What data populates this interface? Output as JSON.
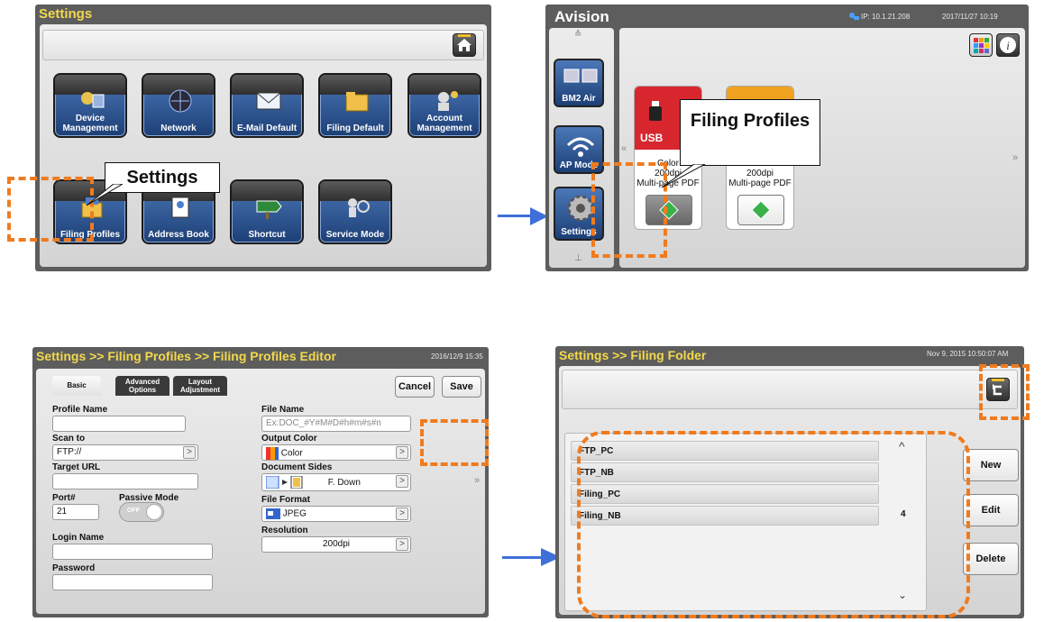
{
  "panel1": {
    "title": "Settings",
    "tiles": [
      {
        "label": "Device Management",
        "icon": "device-management-icon"
      },
      {
        "label": "Network",
        "icon": "network-globe-icon"
      },
      {
        "label": "E-Mail Default",
        "icon": "envelope-icon"
      },
      {
        "label": "Filing Default",
        "icon": "folder-icon"
      },
      {
        "label": "Account Management",
        "icon": "account-icon"
      },
      {
        "label": "Filing Profiles",
        "icon": "filing-profiles-icon"
      },
      {
        "label": "Address Book",
        "icon": "address-book-icon"
      },
      {
        "label": "Shortcut",
        "icon": "shortcut-sign-icon"
      },
      {
        "label": "Service Mode",
        "icon": "service-mode-icon"
      }
    ],
    "callout": "Settings",
    "home_icon": "home-icon"
  },
  "panel2": {
    "brand": "Avision",
    "ip": "IP: 10.1.21.208",
    "datetime": "2017/11/27 10:19",
    "side_items": [
      {
        "label": "BM2 Air",
        "icon": "bm2-air-icon"
      },
      {
        "label": "AP Mode",
        "icon": "wifi-ap-icon"
      },
      {
        "label": "Settings",
        "icon": "gear-icon"
      }
    ],
    "cards": [
      {
        "badge": "USB",
        "lines": [
          "Color",
          "200dpi",
          "Multi-page PDF"
        ],
        "accent": "#d8262e"
      },
      {
        "badge": "",
        "lines": [
          "Color",
          "200dpi",
          "Multi-page PDF"
        ],
        "accent": "#f0a21e"
      }
    ],
    "callout": "Filing Profiles",
    "prev_label": "«",
    "next_label": "»"
  },
  "panel3": {
    "title": "Settings >> Filing Profiles >> Filing Profiles Editor",
    "datetime": "2016/12/9 15:35",
    "tabs": [
      {
        "label": "Basic"
      },
      {
        "label": "Advanced Options"
      },
      {
        "label": "Layout Adjustment"
      }
    ],
    "cancel_label": "Cancel",
    "save_label": "Save",
    "profile_name_label": "Profile Name",
    "profile_name_value": "",
    "scan_to_label": "Scan to",
    "scan_to_value": "FTP://",
    "target_url_label": "Target URL",
    "target_url_value": "",
    "port_label": "Port#",
    "port_value": "21",
    "passive_mode_label": "Passive Mode",
    "passive_mode_state": "OFF",
    "login_name_label": "Login Name",
    "login_name_value": "",
    "password_label": "Password",
    "password_value": "",
    "file_name_label": "File Name",
    "file_name_placeholder": "Ex:DOC_#Y#M#D#h#m#s#n",
    "output_color_label": "Output Color",
    "output_color_value": "Color",
    "document_sides_label": "Document Sides",
    "document_sides_value": "F. Down",
    "file_format_label": "File Format",
    "file_format_value": "JPEG",
    "resolution_label": "Resolution",
    "resolution_value": "200dpi",
    "next_label": "»"
  },
  "panel4": {
    "title": "Settings >> Filing Folder",
    "datetime": "Nov 9, 2015 10:50:07 AM",
    "folders": [
      "FTP_PC",
      "FTP_NB",
      "Filing_PC",
      "Filing_NB"
    ],
    "count": "4",
    "new_label": "New",
    "edit_label": "Edit",
    "delete_label": "Delete",
    "back_icon": "back-arrow-icon"
  },
  "colors": {
    "title_yellow": "#f2d94c",
    "highlight_orange": "#f07b1e",
    "arrow_blue": "#3f6fd8",
    "tile_blue": "#1d3f76"
  }
}
